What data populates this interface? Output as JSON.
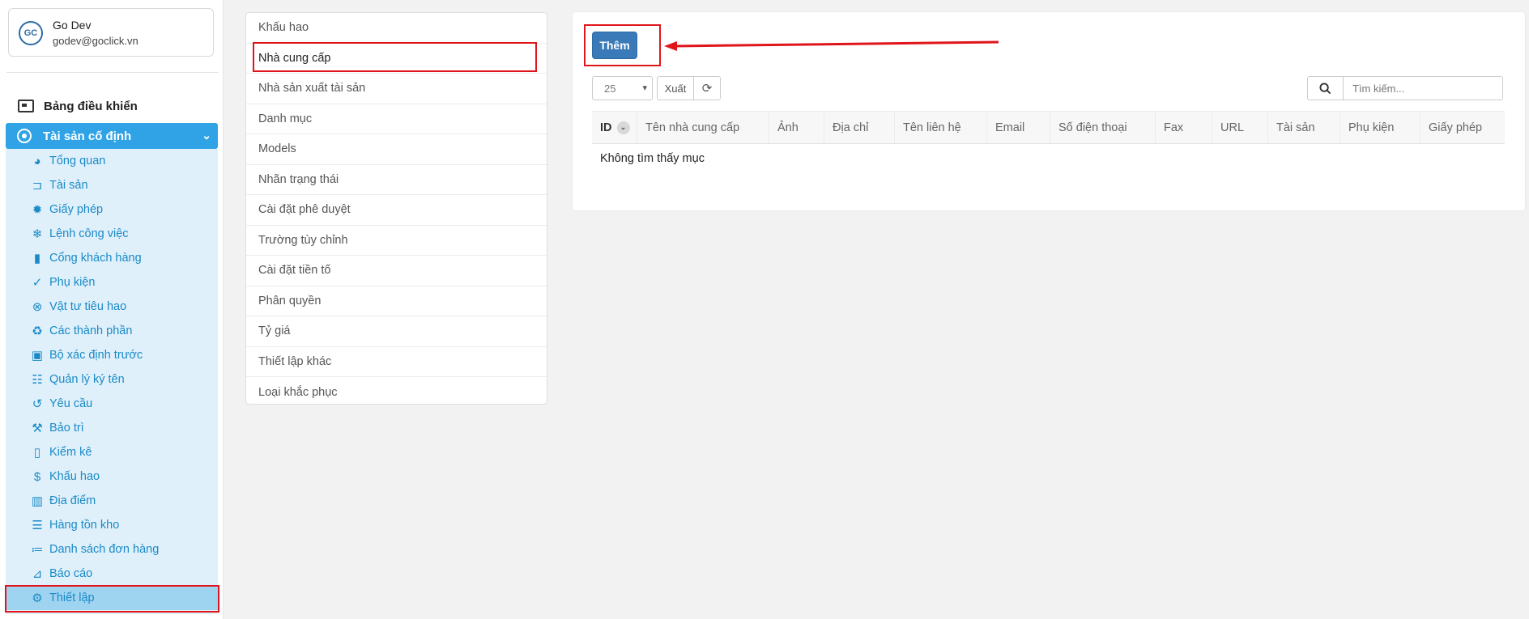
{
  "user": {
    "name": "Go Dev",
    "email": "godev@goclick.vn",
    "avatar_text": "GC"
  },
  "sidebar": {
    "dashboard_label": "Bảng điều khiển",
    "group_label": "Tài sản cố định",
    "items": [
      {
        "label": "Tổng quan",
        "icon": "dashboard-gauge-icon"
      },
      {
        "label": "Tài sản",
        "icon": "asset-icon"
      },
      {
        "label": "Giấy phép",
        "icon": "license-gear-icon"
      },
      {
        "label": "Lệnh công việc",
        "icon": "snowflake-icon"
      },
      {
        "label": "Cổng khách hàng",
        "icon": "bookmark-icon"
      },
      {
        "label": "Phụ kiện",
        "icon": "check-icon"
      },
      {
        "label": "Vật tư tiêu hao",
        "icon": "lifebuoy-icon"
      },
      {
        "label": "Các thành phần",
        "icon": "recycle-icon"
      },
      {
        "label": "Bộ xác định trước",
        "icon": "kit-icon"
      },
      {
        "label": "Quản lý ký tên",
        "icon": "handshake-icon"
      },
      {
        "label": "Yêu cầu",
        "icon": "undo-icon"
      },
      {
        "label": "Bảo trì",
        "icon": "wrench-icon"
      },
      {
        "label": "Kiểm kê",
        "icon": "file-icon"
      },
      {
        "label": "Khấu hao",
        "icon": "dollar-icon"
      },
      {
        "label": "Địa điểm",
        "icon": "map-icon"
      },
      {
        "label": "Hàng tồn kho",
        "icon": "indent-icon"
      },
      {
        "label": "Danh sách đơn hàng",
        "icon": "list-icon"
      },
      {
        "label": "Báo cáo",
        "icon": "chart-icon"
      },
      {
        "label": "Thiết lập",
        "icon": "cogs-icon"
      }
    ]
  },
  "settings_menu": [
    "Khấu hao",
    "Nhà cung cấp",
    "Nhà sản xuất tài sản",
    "Danh mục",
    "Models",
    "Nhãn trạng thái",
    "Cài đặt phê duyệt",
    "Trường tùy chỉnh",
    "Cài đặt tiền tố",
    "Phân quyền",
    "Tỷ giá",
    "Thiết lập khác",
    "Loại khắc phục"
  ],
  "toolbar": {
    "add_label": "Thêm",
    "page_size": "25",
    "export_label": "Xuất",
    "search_placeholder": "Tìm kiếm..."
  },
  "table": {
    "columns": [
      "ID",
      "Tên nhà cung cấp",
      "Ảnh",
      "Địa chỉ",
      "Tên liên hệ",
      "Email",
      "Số điện thoại",
      "Fax",
      "URL",
      "Tài sản",
      "Phụ kiện",
      "Giấy phép"
    ],
    "empty_message": "Không tìm thấy mục"
  },
  "colors": {
    "accent": "#2fa3e6",
    "submenu_bg": "#dff0fb",
    "active_bg": "#9fd4f1",
    "button_primary": "#3a7ab8",
    "annotation": "#e0151b"
  }
}
